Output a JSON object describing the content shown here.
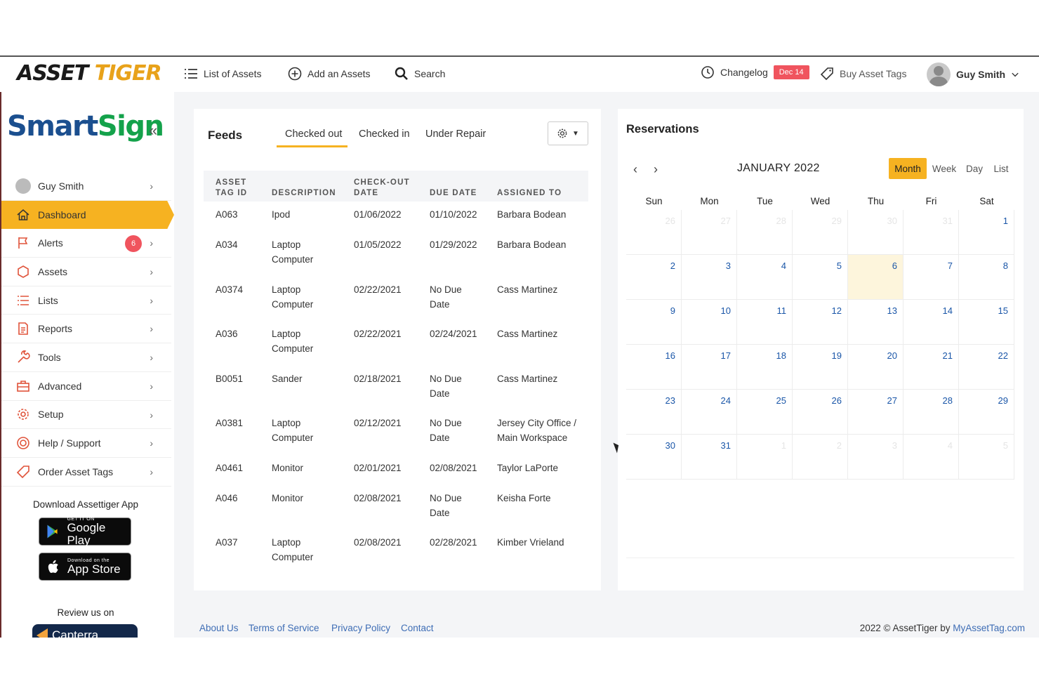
{
  "topbar": {
    "logo_part1": "ASSET",
    "logo_part2": "TIGER",
    "list_assets": "List of Assets",
    "add_asset": "Add an Assets",
    "search": "Search",
    "changelog": "Changelog",
    "changelog_badge": "Dec 14",
    "buy_tags": "Buy Asset Tags",
    "user_name": "Guy Smith"
  },
  "sidebar": {
    "brand_part1": "Smart",
    "brand_part2": "Sign",
    "collapse": "«",
    "items": [
      {
        "label": "Guy Smith"
      },
      {
        "label": "Dashboard"
      },
      {
        "label": "Alerts",
        "badge": "6"
      },
      {
        "label": "Assets"
      },
      {
        "label": "Lists"
      },
      {
        "label": "Reports"
      },
      {
        "label": "Tools"
      },
      {
        "label": "Advanced"
      },
      {
        "label": "Setup"
      },
      {
        "label": "Help / Support"
      },
      {
        "label": "Order Asset Tags"
      }
    ],
    "download_title": "Download Assettiger App",
    "google_small": "GET IT ON",
    "google_big": "Google Play",
    "apple_small": "Download on the",
    "apple_big": "App Store",
    "review_title": "Review us on",
    "capterra": "Capterra"
  },
  "feeds": {
    "title": "Feeds",
    "tabs": [
      "Checked out",
      "Checked in",
      "Under Repair"
    ],
    "headers": [
      "ASSET\nTAG ID",
      "DESCRIPTION",
      "CHECK-OUT\nDATE",
      "DUE DATE",
      "ASSIGNED TO"
    ],
    "rows": [
      [
        "A063",
        "Ipod",
        "01/06/2022",
        "01/10/2022",
        "Barbara Bodean"
      ],
      [
        "A034",
        "Laptop\nComputer",
        "01/05/2022",
        "01/29/2022",
        "Barbara Bodean"
      ],
      [
        "A0374",
        "Laptop\nComputer",
        "02/22/2021",
        "No Due\nDate",
        "Cass Martinez"
      ],
      [
        "A036",
        "Laptop\nComputer",
        "02/22/2021",
        "02/24/2021",
        "Cass Martinez"
      ],
      [
        "B0051",
        "Sander",
        "02/18/2021",
        "No Due\nDate",
        "Cass Martinez"
      ],
      [
        "A0381",
        "Laptop\nComputer",
        "02/12/2021",
        "No Due\nDate",
        "Jersey City Office /\nMain Workspace"
      ],
      [
        "A0461",
        "Monitor",
        "02/01/2021",
        "02/08/2021",
        "Taylor LaPorte"
      ],
      [
        "A046",
        "Monitor",
        "02/08/2021",
        "No Due\nDate",
        "Keisha Forte"
      ],
      [
        "A037",
        "Laptop\nComputer",
        "02/08/2021",
        "02/28/2021",
        "Kimber Vrieland"
      ]
    ]
  },
  "reservations": {
    "title": "Reservations",
    "month_title": "JANUARY 2022",
    "prev": "‹",
    "next": "›",
    "views": [
      "Month",
      "Week",
      "Day",
      "List"
    ],
    "days_of_week": [
      "Sun",
      "Mon",
      "Tue",
      "Wed",
      "Thu",
      "Fri",
      "Sat"
    ],
    "weeks": [
      [
        "26",
        "27",
        "28",
        "29",
        "30",
        "31",
        "1"
      ],
      [
        "2",
        "3",
        "4",
        "5",
        "6",
        "7",
        "8"
      ],
      [
        "9",
        "10",
        "11",
        "12",
        "13",
        "14",
        "15"
      ],
      [
        "16",
        "17",
        "18",
        "19",
        "20",
        "21",
        "22"
      ],
      [
        "23",
        "24",
        "25",
        "26",
        "27",
        "28",
        "29"
      ],
      [
        "30",
        "31",
        "1",
        "2",
        "3",
        "4",
        "5"
      ]
    ],
    "today": "6"
  },
  "footer": {
    "links": [
      "About Us",
      "Terms of Service",
      "Privacy Policy",
      "Contact"
    ],
    "copyright": "2022 © AssetTiger by ",
    "copyright_link": "MyAssetTag.com"
  },
  "colors": {
    "accent": "#f6b221",
    "badge": "#f0545e",
    "link": "#3e6db5",
    "calendar_date": "#1a56a8"
  }
}
